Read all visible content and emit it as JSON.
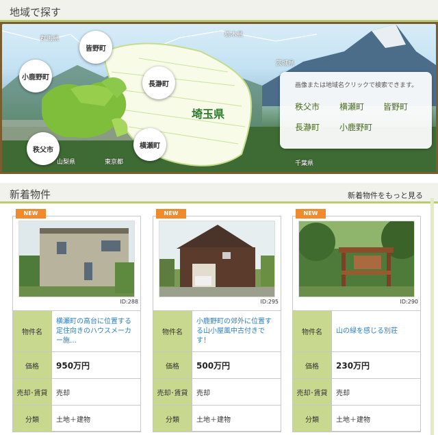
{
  "region_section": {
    "title": "地域で探す",
    "map_labels": {
      "gunma": "群馬県",
      "tochigi": "栃木県",
      "ibaraki": "茨城県",
      "yamanashi": "山梨県",
      "tokyo": "東京都",
      "chiba": "千葉県",
      "saitama": "埼玉県"
    },
    "bubbles": {
      "minano": "皆野町",
      "ogano": "小鹿野町",
      "nagatoro": "長瀞町",
      "yokoze": "横瀬町",
      "chichibu": "秩父市"
    },
    "info": {
      "hint": "画像または地域名クリックで検索できます。",
      "towns": [
        "秩父市",
        "横瀬町",
        "皆野町",
        "長瀞町",
        "小鹿野町"
      ]
    }
  },
  "listings_section": {
    "title": "新着物件",
    "more_link": "新着物件をもっと見る",
    "badge": "NEW",
    "labels": {
      "name": "物件名",
      "price": "価格",
      "sale_type": "売却･賃貸",
      "category": "分類"
    },
    "items": [
      {
        "id": "ID:288",
        "name": "横瀬町の高台に位置する定住向きのハウスメーカー施…",
        "price": "950万円",
        "sale_type": "売却",
        "category": "土地＋建物"
      },
      {
        "id": "ID:295",
        "name": "小鹿野町の郊外に位置する山小屋風中古付きです！",
        "price": "500万円",
        "sale_type": "売却",
        "category": "土地＋建物"
      },
      {
        "id": "ID:290",
        "name": "山の緑を感じる別荘",
        "price": "230万円",
        "sale_type": "売却",
        "category": "土地＋建物"
      }
    ]
  },
  "colors": {
    "accent_green": "#b9cc6e",
    "label_green": "#c9d88f",
    "badge_orange": "#f08a2c",
    "link_blue": "#2a7fc6"
  }
}
